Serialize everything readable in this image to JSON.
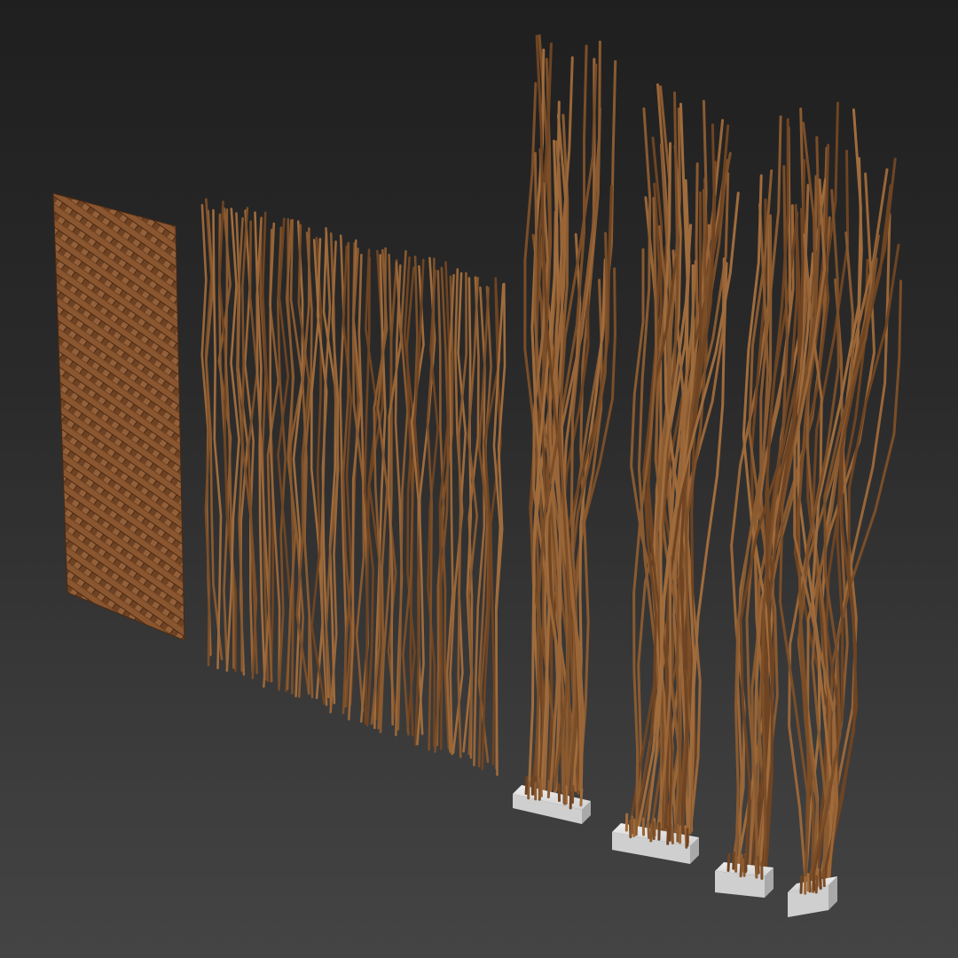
{
  "scene": {
    "background_top": "#1f1f1f",
    "background_bottom": "#444444",
    "objects": [
      {
        "kind": "woven-mat-panel",
        "color": "#7a4a26"
      },
      {
        "kind": "bamboo-stick-screen",
        "color": "#8a5a30"
      },
      {
        "kind": "bamboo-sticks-in-base",
        "color": "#8a5a30",
        "base_color": "#d9d9d9"
      },
      {
        "kind": "bamboo-sticks-in-base",
        "color": "#8a5a30",
        "base_color": "#d9d9d9"
      },
      {
        "kind": "bamboo-sticks-in-base",
        "color": "#8a5a30",
        "base_color": "#d9d9d9"
      },
      {
        "kind": "bamboo-sticks-in-base",
        "color": "#8a5a30",
        "base_color": "#d9d9d9"
      }
    ]
  }
}
